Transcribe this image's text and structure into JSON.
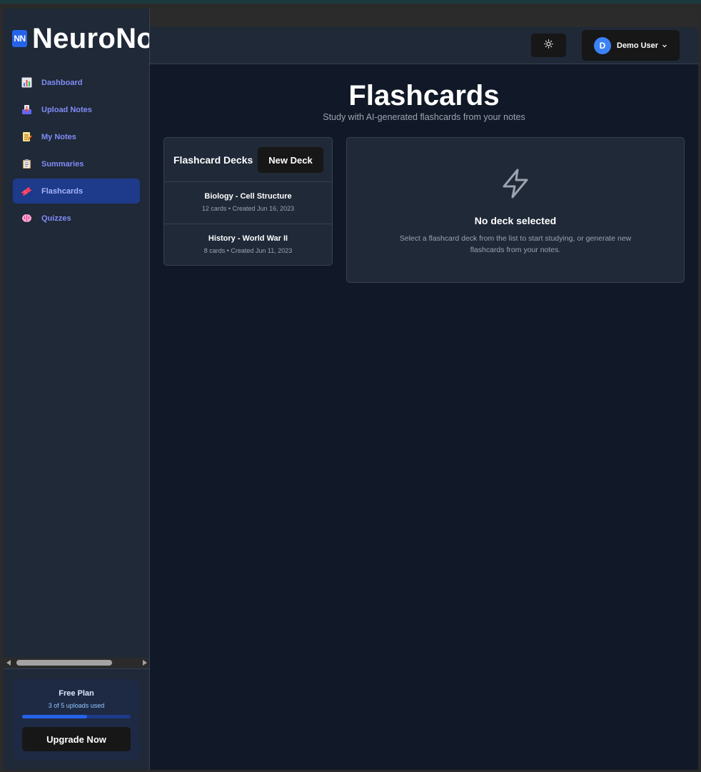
{
  "brand": {
    "logo_text": "NN",
    "name": "NeuroNotes"
  },
  "sidebar": {
    "items": [
      {
        "label": "Dashboard",
        "icon": "bar-chart-icon",
        "active": false
      },
      {
        "label": "Upload Notes",
        "icon": "inbox-tray-icon",
        "active": false
      },
      {
        "label": "My Notes",
        "icon": "memo-icon",
        "active": false
      },
      {
        "label": "Summaries",
        "icon": "clipboard-icon",
        "active": false
      },
      {
        "label": "Flashcards",
        "icon": "ticket-icon",
        "active": true
      },
      {
        "label": "Quizzes",
        "icon": "brain-icon",
        "active": false
      }
    ],
    "plan": {
      "title": "Free Plan",
      "usage": "3 of 5 uploads used",
      "progress": 0.6,
      "upgrade_label": "Upgrade Now"
    }
  },
  "header": {
    "theme_icon": "sun-icon",
    "user": {
      "initial": "D",
      "name": "Demo User"
    }
  },
  "page": {
    "title": "Flashcards",
    "subtitle": "Study with AI-generated flashcards from your notes"
  },
  "decks": {
    "title": "Flashcard Decks",
    "new_label": "New Deck",
    "items": [
      {
        "name": "Biology - Cell Structure",
        "meta": "12 cards • Created Jun 16, 2023"
      },
      {
        "name": "History - World War II",
        "meta": "8 cards • Created Jun 11, 2023"
      }
    ]
  },
  "study": {
    "icon": "lightning-icon",
    "title": "No deck selected",
    "text": "Select a flashcard deck from the list to start studying, or generate new flashcards from your notes."
  },
  "colors": {
    "accent": "#2563eb",
    "active_nav": "#1e3a8a",
    "nav_text": "#818cf8"
  }
}
